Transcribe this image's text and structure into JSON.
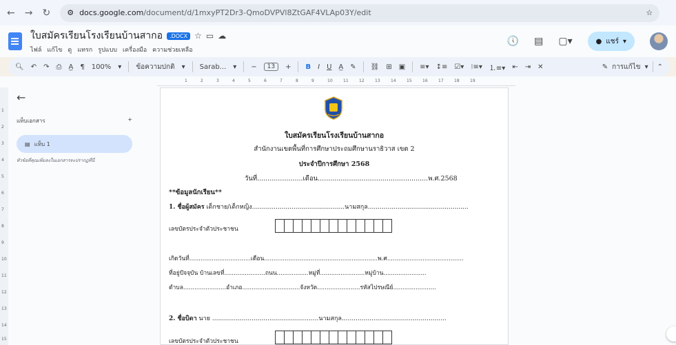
{
  "browser": {
    "url_host": "docs.google.com",
    "url_path": "/document/d/1mxyPT2Dr3-QmoDVPVl8ZtGAF4VLAp03Y/edit"
  },
  "doc": {
    "title": "ใบสมัครเรียนโรงเรียนบ้านสากอ",
    "badge": ".DOCX",
    "menus": [
      "ไฟล์",
      "แก้ไข",
      "ดู",
      "แทรก",
      "รูปแบบ",
      "เครื่องมือ",
      "ความช่วยเหลือ"
    ],
    "share_label": "แชร์"
  },
  "toolbar": {
    "zoom": "100%",
    "style": "ข้อความปกติ",
    "font": "Sarab...",
    "size": "13",
    "editing": "การแก้ไข"
  },
  "ruler": {
    "h": [
      "1",
      "2",
      "3",
      "4",
      "5",
      "6",
      "7",
      "8",
      "9",
      "10",
      "11",
      "12",
      "13",
      "14",
      "15",
      "16",
      "17",
      "18",
      "19"
    ],
    "v": [
      "1",
      "2",
      "3",
      "4",
      "5",
      "6",
      "7",
      "8",
      "9",
      "10",
      "11",
      "12",
      "13",
      "14",
      "15"
    ]
  },
  "sidebar": {
    "header": "แท็บเอกสาร",
    "tab_label": "แท็บ 1",
    "hint": "หัวข้อที่คุณเพิ่มลงในเอกสารจะปรากฏที่นี่"
  },
  "form": {
    "title": "ใบสมัครเรียนโรงเรียนบ้านสากอ",
    "office": "สำนักงานเขตพื้นที่การศึกษาประถมศึกษานราธิวาส เขต 2",
    "year": "ประจำปีการศึกษา 2568",
    "date_line": "วันที่......................เดือน.....................................................พ.ศ.2568",
    "section": "**ข้อมูลนักเรียน**",
    "q1_label": "1. ชื่อผู้สมัคร",
    "q1_rest": " เด็กชาย/เด็กหญิง...............................................นามสกุล...................................................",
    "id_label_1": "เลขบัตรประจำตัวประชาชน",
    "birth_line": "เกิดวันที่.................................เดือน.............................................................พ.ศ.........................................",
    "address_line": "ที่อยู่ปัจจุบัน  บ้านเลขที่......................ถนน.................หมู่ที่........................หมู่บ้าน.......................",
    "district_line": "ตำบล.......................อำเภอ...............................จังหวัด.......................รหัสไปรษณีย์.......................",
    "q2_label": "2. ชื่อบิดา",
    "q2_rest": " นาย ......................................................นามสกุล.....................................................",
    "id_label_2": "เลขบัตรประจำตัวประชาชน"
  }
}
